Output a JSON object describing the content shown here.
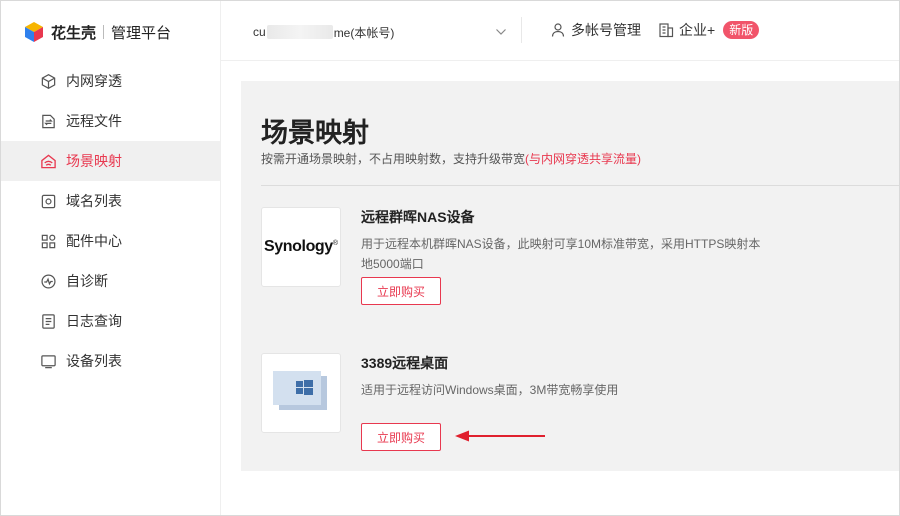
{
  "brand": {
    "name": "花生壳",
    "subtitle": "管理平台"
  },
  "sidebar": {
    "items": [
      {
        "label": "内网穿透",
        "icon": "cube-icon",
        "active": false
      },
      {
        "label": "远程文件",
        "icon": "file-transfer-icon",
        "active": false
      },
      {
        "label": "场景映射",
        "icon": "scene-map-icon",
        "active": true
      },
      {
        "label": "域名列表",
        "icon": "domain-icon",
        "active": false
      },
      {
        "label": "配件中心",
        "icon": "grid-icon",
        "active": false
      },
      {
        "label": "自诊断",
        "icon": "pulse-icon",
        "active": false
      },
      {
        "label": "日志查询",
        "icon": "log-icon",
        "active": false
      },
      {
        "label": "设备列表",
        "icon": "monitor-icon",
        "active": false
      }
    ]
  },
  "topbar": {
    "account_prefix": "cu",
    "account_suffix": "me(本帐号)",
    "multi_account": "多帐号管理",
    "enterprise": "企业+",
    "new_badge": "新版"
  },
  "page": {
    "title": "场景映射",
    "desc": "按需开通场景映射，不占用映射数，支持升级带宽",
    "desc_highlight": "(与内网穿透共享流量)"
  },
  "cards": [
    {
      "logo_text": "Synology",
      "title": "远程群晖NAS设备",
      "desc": "用于远程本机群晖NAS设备，此映射可享10M标准带宽，采用HTTPS映射本地5000端口",
      "button": "立即购买"
    },
    {
      "title": "3389远程桌面",
      "desc": "适用于远程访问Windows桌面，3M带宽畅享使用",
      "button": "立即购买"
    }
  ],
  "colors": {
    "accent": "#e8384f",
    "active_bg": "#f0f0f0",
    "panel_bg": "#f2f2f2"
  }
}
